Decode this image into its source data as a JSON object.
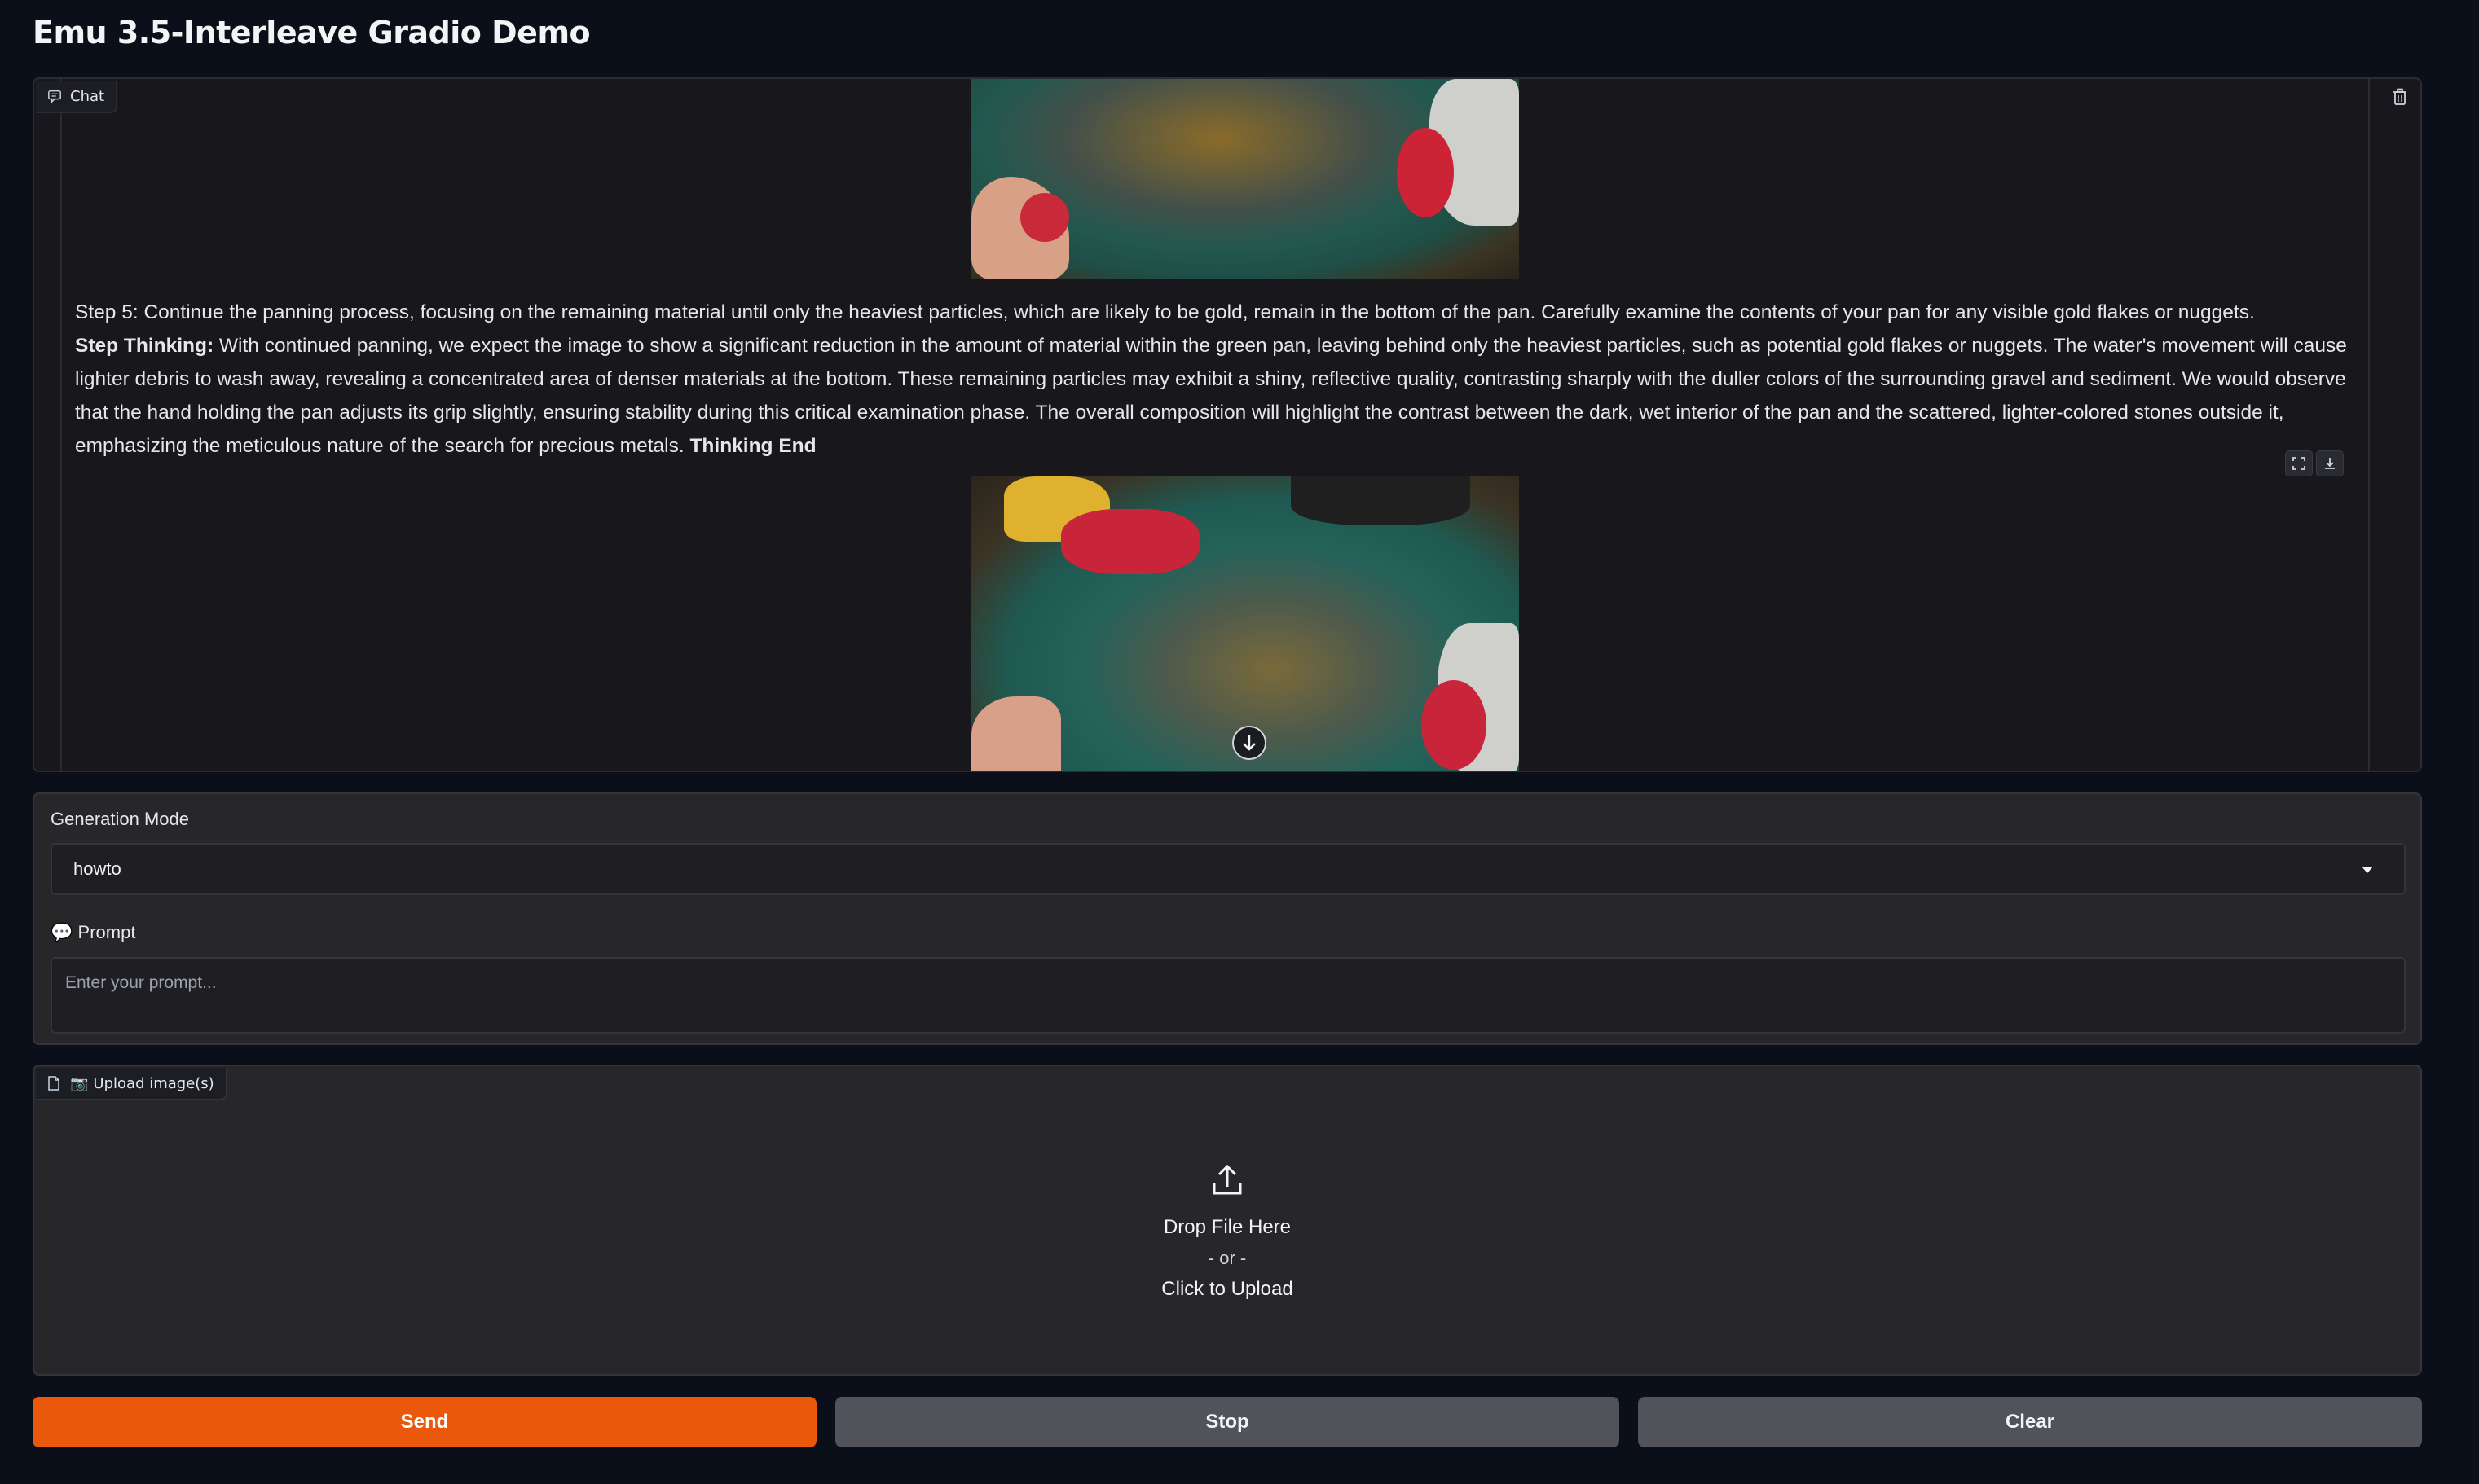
{
  "page": {
    "title": "Emu 3.5-Interleave Gradio Demo"
  },
  "chat": {
    "label": "Chat",
    "message": {
      "step_line": "Step 5: Continue the panning process, focusing on the remaining material until only the heaviest particles, which are likely to be gold, remain in the bottom of the pan. Carefully examine the contents of your pan for any visible gold flakes or nuggets.",
      "thinking_label": "Step Thinking:",
      "thinking_text": " With continued panning, we expect the image to show a significant reduction in the amount of material within the green pan, leaving behind only the heaviest particles, such as potential gold flakes or nuggets. The water's movement will cause lighter debris to wash away, revealing a concentrated area of denser materials at the bottom. These remaining particles may exhibit a shiny, reflective quality, contrasting sharply with the duller colors of the surrounding gravel and sediment. We would observe that the hand holding the pan adjusts its grip slightly, ensuring stability during this critical examination phase. The overall composition will highlight the contrast between the dark, wet interior of the pan and the scattered, lighter-colored stones outside it, emphasizing the meticulous nature of the search for precious metals. ",
      "thinking_end": "Thinking End"
    }
  },
  "controls": {
    "mode_label": "Generation Mode",
    "mode_value": "howto",
    "prompt_label": "Prompt",
    "prompt_icon": "💬",
    "prompt_placeholder": "Enter your prompt..."
  },
  "upload": {
    "label": "Upload image(s)",
    "label_icon": "📷",
    "drop_text": "Drop File Here",
    "or_text": "- or -",
    "click_text": "Click to Upload"
  },
  "buttons": {
    "send": "Send",
    "stop": "Stop",
    "clear": "Clear"
  },
  "colors": {
    "accent": "#ea580c",
    "background": "#0b0f19",
    "panel": "#27272a"
  }
}
